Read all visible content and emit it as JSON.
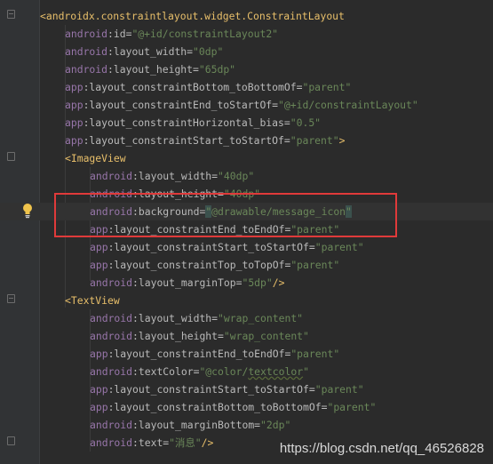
{
  "editor": {
    "lines": [
      {
        "indent": 0,
        "tokens": [
          {
            "t": "<androidx.constraintlayout.widget.ConstraintLayout",
            "c": "t-tag"
          }
        ]
      },
      {
        "indent": 1,
        "tokens": [
          {
            "t": "android",
            "c": "t-ns-android"
          },
          {
            "t": ":id=",
            "c": "t-attr"
          },
          {
            "t": "\"@+id/constraintLayout2\"",
            "c": "t-str"
          }
        ]
      },
      {
        "indent": 1,
        "tokens": [
          {
            "t": "android",
            "c": "t-ns-android"
          },
          {
            "t": ":layout_width=",
            "c": "t-attr"
          },
          {
            "t": "\"0dp\"",
            "c": "t-str"
          }
        ]
      },
      {
        "indent": 1,
        "tokens": [
          {
            "t": "android",
            "c": "t-ns-android"
          },
          {
            "t": ":layout_height=",
            "c": "t-attr"
          },
          {
            "t": "\"65dp\"",
            "c": "t-str"
          }
        ]
      },
      {
        "indent": 1,
        "tokens": [
          {
            "t": "app",
            "c": "t-ns-app"
          },
          {
            "t": ":layout_constraintBottom_toBottomOf=",
            "c": "t-attr"
          },
          {
            "t": "\"parent\"",
            "c": "t-str"
          }
        ]
      },
      {
        "indent": 1,
        "tokens": [
          {
            "t": "app",
            "c": "t-ns-app"
          },
          {
            "t": ":layout_constraintEnd_toStartOf=",
            "c": "t-attr"
          },
          {
            "t": "\"@+id/constraintLayout\"",
            "c": "t-str"
          }
        ]
      },
      {
        "indent": 1,
        "tokens": [
          {
            "t": "app",
            "c": "t-ns-app"
          },
          {
            "t": ":layout_constraintHorizontal_bias=",
            "c": "t-attr"
          },
          {
            "t": "\"0.5\"",
            "c": "t-str"
          }
        ]
      },
      {
        "indent": 1,
        "tokens": [
          {
            "t": "app",
            "c": "t-ns-app"
          },
          {
            "t": ":layout_constraintStart_toStartOf=",
            "c": "t-attr"
          },
          {
            "t": "\"parent\"",
            "c": "t-str"
          },
          {
            "t": ">",
            "c": "t-tag"
          }
        ]
      },
      {
        "indent": 1,
        "tokens": [
          {
            "t": "<ImageView",
            "c": "t-tag"
          }
        ]
      },
      {
        "indent": 2,
        "tokens": [
          {
            "t": "android",
            "c": "t-ns-android"
          },
          {
            "t": ":layout_width=",
            "c": "t-attr"
          },
          {
            "t": "\"40dp\"",
            "c": "t-str"
          }
        ]
      },
      {
        "indent": 2,
        "tokens": [
          {
            "t": "android",
            "c": "t-ns-android"
          },
          {
            "t": ":layout_height=",
            "c": "t-attr"
          },
          {
            "t": "\"40dp\"",
            "c": "t-str"
          }
        ]
      },
      {
        "indent": 2,
        "current": true,
        "tokens": [
          {
            "t": "android",
            "c": "t-ns-android"
          },
          {
            "t": ":background=",
            "c": "t-attr"
          },
          {
            "t": "\"",
            "c": "t-str t-hl"
          },
          {
            "t": "@drawable/message_icon",
            "c": "t-str"
          },
          {
            "t": "\"",
            "c": "t-str t-hl"
          }
        ]
      },
      {
        "indent": 2,
        "tokens": [
          {
            "t": "app",
            "c": "t-ns-app"
          },
          {
            "t": ":layout_constraintEnd_toEndOf=",
            "c": "t-attr"
          },
          {
            "t": "\"parent\"",
            "c": "t-str"
          }
        ]
      },
      {
        "indent": 2,
        "tokens": [
          {
            "t": "app",
            "c": "t-ns-app"
          },
          {
            "t": ":layout_constraintStart_toStartOf=",
            "c": "t-attr"
          },
          {
            "t": "\"parent\"",
            "c": "t-str"
          }
        ]
      },
      {
        "indent": 2,
        "tokens": [
          {
            "t": "app",
            "c": "t-ns-app"
          },
          {
            "t": ":layout_constraintTop_toTopOf=",
            "c": "t-attr"
          },
          {
            "t": "\"parent\"",
            "c": "t-str"
          }
        ]
      },
      {
        "indent": 2,
        "tokens": [
          {
            "t": "android",
            "c": "t-ns-android"
          },
          {
            "t": ":layout_marginTop=",
            "c": "t-attr"
          },
          {
            "t": "\"5dp\"",
            "c": "t-str"
          },
          {
            "t": "/>",
            "c": "t-tag"
          }
        ]
      },
      {
        "indent": 1,
        "tokens": [
          {
            "t": "<TextView",
            "c": "t-tag"
          }
        ]
      },
      {
        "indent": 2,
        "tokens": [
          {
            "t": "android",
            "c": "t-ns-android"
          },
          {
            "t": ":layout_width=",
            "c": "t-attr"
          },
          {
            "t": "\"wrap_content\"",
            "c": "t-str"
          }
        ]
      },
      {
        "indent": 2,
        "tokens": [
          {
            "t": "android",
            "c": "t-ns-android"
          },
          {
            "t": ":layout_height=",
            "c": "t-attr"
          },
          {
            "t": "\"wrap_content\"",
            "c": "t-str"
          }
        ]
      },
      {
        "indent": 2,
        "tokens": [
          {
            "t": "app",
            "c": "t-ns-app"
          },
          {
            "t": ":layout_constraintEnd_toEndOf=",
            "c": "t-attr"
          },
          {
            "t": "\"parent\"",
            "c": "t-str"
          }
        ]
      },
      {
        "indent": 2,
        "tokens": [
          {
            "t": "android",
            "c": "t-ns-android"
          },
          {
            "t": ":textColor=",
            "c": "t-attr"
          },
          {
            "t": "\"@color/",
            "c": "t-str"
          },
          {
            "t": "textcolor",
            "c": "t-str t-wave"
          },
          {
            "t": "\"",
            "c": "t-str"
          }
        ]
      },
      {
        "indent": 2,
        "tokens": [
          {
            "t": "app",
            "c": "t-ns-app"
          },
          {
            "t": ":layout_constraintStart_toStartOf=",
            "c": "t-attr"
          },
          {
            "t": "\"parent\"",
            "c": "t-str"
          }
        ]
      },
      {
        "indent": 2,
        "tokens": [
          {
            "t": "app",
            "c": "t-ns-app"
          },
          {
            "t": ":layout_constraintBottom_toBottomOf=",
            "c": "t-attr"
          },
          {
            "t": "\"parent\"",
            "c": "t-str"
          }
        ]
      },
      {
        "indent": 2,
        "tokens": [
          {
            "t": "android",
            "c": "t-ns-android"
          },
          {
            "t": ":layout_marginBottom=",
            "c": "t-attr"
          },
          {
            "t": "\"2dp\"",
            "c": "t-str"
          }
        ]
      },
      {
        "indent": 2,
        "tokens": [
          {
            "t": "android",
            "c": "t-ns-android"
          },
          {
            "t": ":text=",
            "c": "t-attr"
          },
          {
            "t": "\"消息\"",
            "c": "t-str"
          },
          {
            "t": "/>",
            "c": "t-tag"
          }
        ]
      }
    ]
  },
  "watermark": "https://blog.csdn.net/qq_46526828",
  "colors": {
    "background": "#2b2b2b",
    "tag": "#e8bf6a",
    "namespace": "#9876aa",
    "string": "#6a8759",
    "highlight_box": "#e03a3a"
  }
}
